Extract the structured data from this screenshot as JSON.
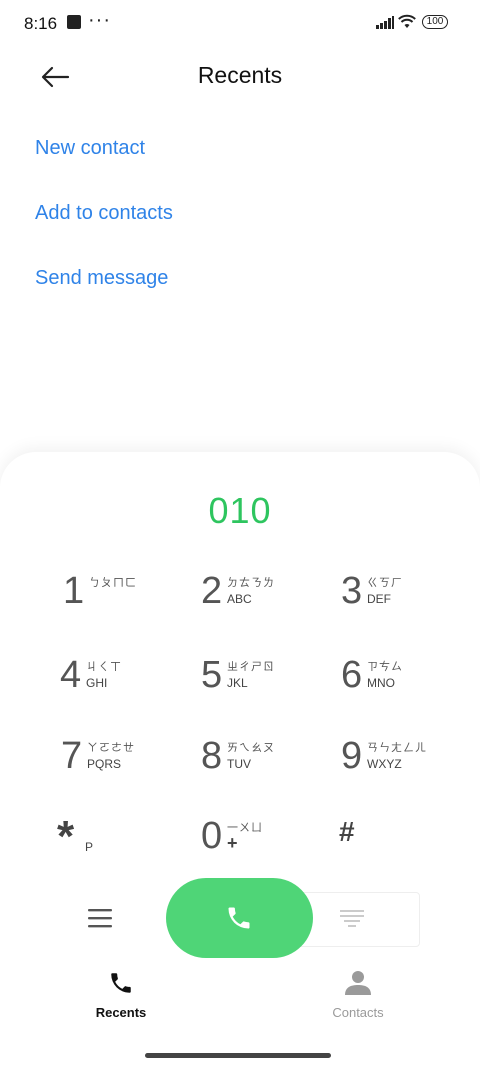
{
  "status_bar": {
    "time": "8:16",
    "dots": "···",
    "battery": "100"
  },
  "header": {
    "title": "Recents"
  },
  "actions": [
    {
      "label": "New contact"
    },
    {
      "label": "Add to contacts"
    },
    {
      "label": "Send message"
    }
  ],
  "dialer": {
    "number": "010",
    "keys": [
      {
        "digit": "1",
        "zh": "ㄅㄆㄇㄈ",
        "letters": ""
      },
      {
        "digit": "2",
        "zh": "ㄉㄊㄋㄌ",
        "letters": "ABC"
      },
      {
        "digit": "3",
        "zh": "ㄍㄎㄏ",
        "letters": "DEF"
      },
      {
        "digit": "4",
        "zh": "ㄐㄑㄒ",
        "letters": "GHI"
      },
      {
        "digit": "5",
        "zh": "ㄓㄔㄕㄖ",
        "letters": "JKL"
      },
      {
        "digit": "6",
        "zh": "ㄗㄘㄙ",
        "letters": "MNO"
      },
      {
        "digit": "7",
        "zh": "ㄚㄛㄜㄝ",
        "letters": "PQRS"
      },
      {
        "digit": "8",
        "zh": "ㄞㄟㄠㄡ",
        "letters": "TUV"
      },
      {
        "digit": "9",
        "zh": "ㄢㄣㄤㄥㄦ",
        "letters": "WXYZ"
      },
      {
        "digit": "*",
        "sub": "P"
      },
      {
        "digit": "0",
        "zh": "一ㄨㄩ",
        "sub": "+"
      },
      {
        "digit": "#"
      }
    ]
  },
  "nav": {
    "recents_label": "Recents",
    "contacts_label": "Contacts"
  },
  "colors": {
    "accent_blue": "#2f83e8",
    "call_green": "#4fd577",
    "number_green": "#2ec55f"
  }
}
